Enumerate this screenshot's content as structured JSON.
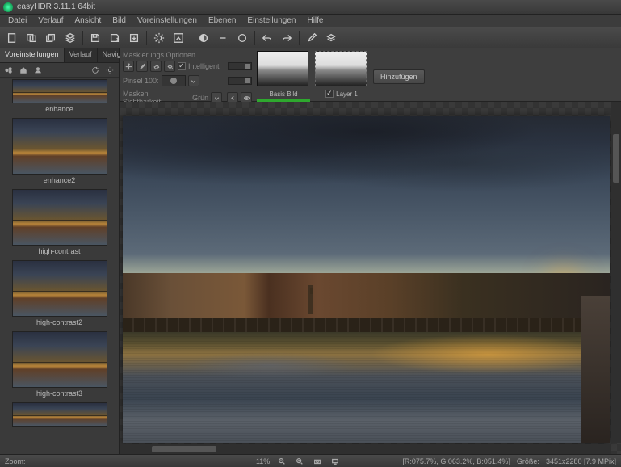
{
  "window": {
    "title": "easyHDR 3.11.1  64bit"
  },
  "menu": {
    "datei": "Datei",
    "verlauf": "Verlauf",
    "ansicht": "Ansicht",
    "bild": "Bild",
    "voreinstellungen": "Voreinstellungen",
    "ebenen": "Ebenen",
    "einstellungen": "Einstellungen",
    "hilfe": "Hilfe"
  },
  "sidebar": {
    "tabs": {
      "voreinstellungen": "Voreinstellungen",
      "verlauf": "Verlauf",
      "navigator": "Navigator"
    },
    "presets": [
      {
        "label": "enhance"
      },
      {
        "label": "enhance2"
      },
      {
        "label": "high-contrast"
      },
      {
        "label": "high-contrast2"
      },
      {
        "label": "high-contrast3"
      }
    ]
  },
  "maskpanel": {
    "header": "Maskierungs Optionen",
    "intelligent": "Intelligent",
    "pinsel": "Pinsel 100:",
    "sichtbarkeit": "Masken Sichtbarkeit:",
    "sichtbarkeit_value": "Grün"
  },
  "layers": {
    "base": "Basis Bild",
    "layer1": "Layer 1",
    "add": "Hinzufügen"
  },
  "status": {
    "zoom_label": "Zoom:",
    "zoom_value": "11%",
    "rgb": "[R:075.7%, G:063.2%, B:051.4%]",
    "size_label": "Größe:",
    "size_value": "3451x2280 [7.9 MPix]"
  }
}
